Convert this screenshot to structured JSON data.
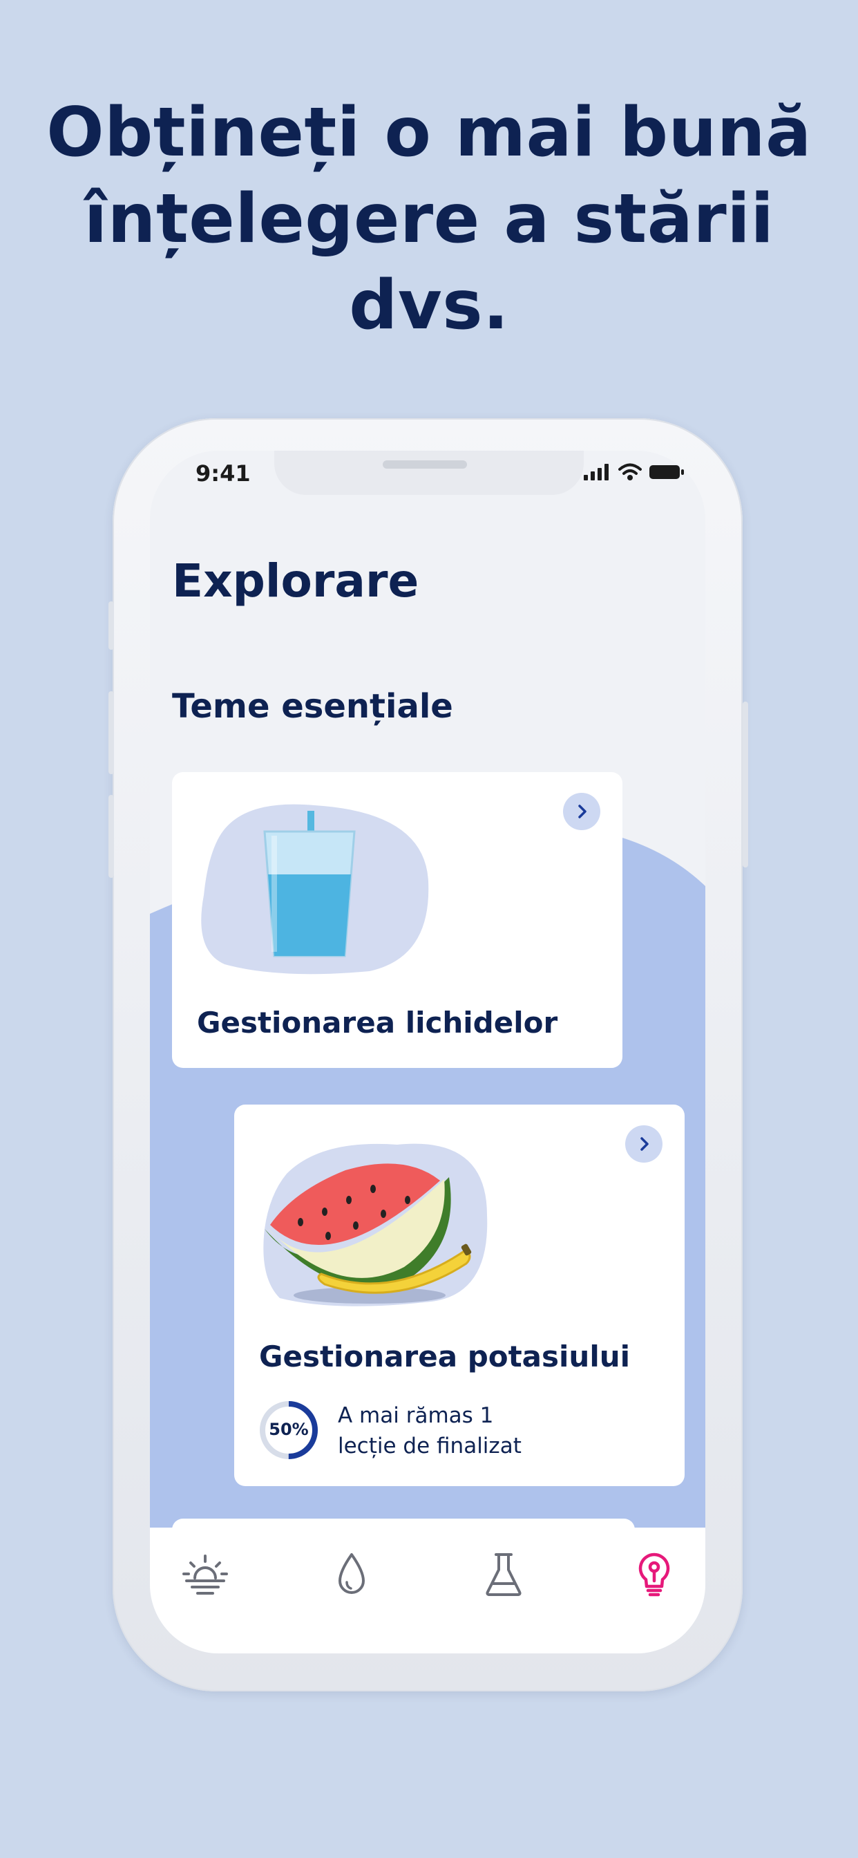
{
  "headline": "Obțineți o mai bună înțelegere a stării dvs.",
  "status_bar": {
    "time": "9:41",
    "icons": [
      "signal-icon",
      "wifi-icon",
      "battery-icon"
    ]
  },
  "screen": {
    "title": "Explorare",
    "section_title": "Teme esențiale",
    "cards": [
      {
        "title": "Gestionarea lichidelor",
        "icon": "glass-of-water-illustration"
      },
      {
        "title": "Gestionarea potasiului",
        "icon": "watermelon-banana-illustration",
        "progress_percent": 50,
        "progress_label": "50%",
        "progress_line1": "A mai rămas 1",
        "progress_line2": "lecție de finalizat"
      }
    ]
  },
  "tabbar": {
    "tabs": [
      {
        "name": "sunrise-icon",
        "active": false
      },
      {
        "name": "drop-icon",
        "active": false
      },
      {
        "name": "flask-icon",
        "active": false
      },
      {
        "name": "lightbulb-icon",
        "active": true
      }
    ]
  },
  "colors": {
    "background": "#cbd8ec",
    "headline": "#0e2252",
    "accent_blue": "#aec2ec",
    "active_tab": "#e6197a",
    "inactive_tab": "#6b6e78",
    "progress_ring": "#1a3b9a"
  }
}
